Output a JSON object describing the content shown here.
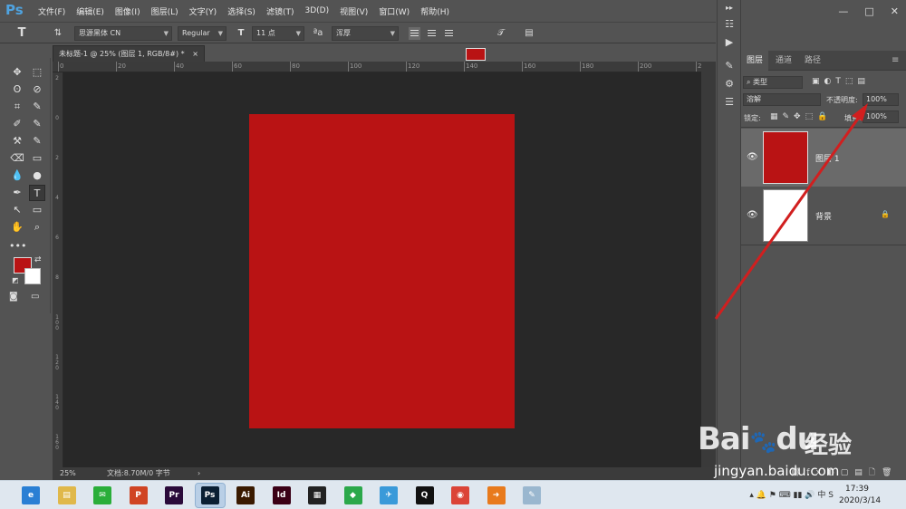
{
  "app": {
    "logo": "Ps"
  },
  "menu": [
    "文件(F)",
    "编辑(E)",
    "图像(I)",
    "图层(L)",
    "文字(Y)",
    "选择(S)",
    "滤镜(T)",
    "3D(D)",
    "视图(V)",
    "窗口(W)",
    "帮助(H)"
  ],
  "window_controls": {
    "minimize": "—",
    "maximize": "□",
    "close": "✕"
  },
  "options": {
    "tool_icon": "T",
    "font_family": "思源黑体 CN",
    "font_style": "Regular",
    "font_size": "11 点",
    "aa_label": "ªa",
    "antialias": "浑厚",
    "text_color": "#b91314"
  },
  "document": {
    "tab_title": "未标题-1 @ 25% (图层 1, RGB/8#) *",
    "tab_close": "×",
    "fill_color": "#b91314",
    "ruler_top": [
      "0",
      "20",
      "40",
      "60",
      "80",
      "100",
      "120",
      "140",
      "160",
      "180",
      "200",
      "220"
    ],
    "ruler_left": [
      "2",
      "0",
      "2",
      "4",
      "6",
      "8",
      "1 0 0",
      "1 2 0",
      "1 4 0",
      "1 6 0"
    ]
  },
  "status": {
    "zoom": "25%",
    "doc_info": "文档:8.70M/0 字节",
    "arrow": "›"
  },
  "toolbar": {
    "fg_color": "#b91314",
    "bg_color": "#ffffff",
    "tools": [
      "✥",
      "⬚",
      "ʘ",
      "⊘",
      "⌗",
      "✎",
      "✐",
      "✎",
      "⚒",
      "✎",
      "⌫",
      "▭",
      "💧",
      "●",
      "✒",
      "T",
      "↖",
      "▭",
      "✋",
      "⌕",
      "•••"
    ]
  },
  "layers_panel": {
    "tabs": [
      "图层",
      "通道",
      "路径"
    ],
    "filter_kind": "类型",
    "blend_mode": "溶解",
    "opacity_label": "不透明度:",
    "opacity_value": "100%",
    "lock_label": "锁定:",
    "fill_label": "填充:",
    "fill_value": "100%",
    "layers": [
      {
        "name": "图层 1",
        "thumb_color": "#b91314",
        "locked": false
      },
      {
        "name": "背景",
        "thumb_color": "#ffffff",
        "locked": true
      }
    ]
  },
  "taskbar": {
    "apps": [
      {
        "name": "browser",
        "label": "e",
        "color": "#2a7fd4"
      },
      {
        "name": "explorer",
        "label": "▤",
        "color": "#e0b84a"
      },
      {
        "name": "wechat",
        "label": "✉",
        "color": "#2aae3a"
      },
      {
        "name": "powerpoint",
        "label": "P",
        "color": "#d04423"
      },
      {
        "name": "premiere",
        "label": "Pr",
        "color": "#2a0a3a"
      },
      {
        "name": "photoshop",
        "label": "Ps",
        "color": "#0a1f33"
      },
      {
        "name": "illustrator",
        "label": "Ai",
        "color": "#3a1a00"
      },
      {
        "name": "indesign",
        "label": "Id",
        "color": "#3a0015"
      },
      {
        "name": "video",
        "label": "▦",
        "color": "#222222"
      },
      {
        "name": "app-green",
        "label": "◆",
        "color": "#2ba84a"
      },
      {
        "name": "app-bird",
        "label": "✈",
        "color": "#3a9ad9"
      },
      {
        "name": "qq",
        "label": "Q",
        "color": "#111111"
      },
      {
        "name": "chrome",
        "label": "◉",
        "color": "#db4437"
      },
      {
        "name": "app-orange",
        "label": "➜",
        "color": "#e87a1c"
      },
      {
        "name": "app-note",
        "label": "✎",
        "color": "#9ab7cf"
      }
    ],
    "time": "17:39",
    "date": "2020/3/14"
  },
  "watermark": {
    "brand": "Bai",
    "brand2": "du",
    "cn": "经验",
    "url": "jingyan.baidu.com"
  }
}
